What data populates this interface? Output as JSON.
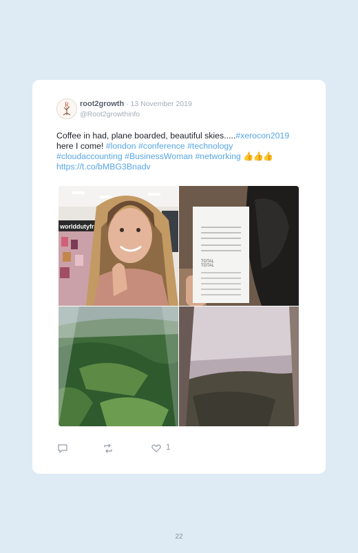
{
  "tweet": {
    "author_name": "root2growth",
    "separator": " · ",
    "date": "13 November 2019",
    "handle": "@Root2growthinfo",
    "avatar_letter": "R",
    "text": {
      "t1": "Coffee in had, plane boarded, beautiful skies.....",
      "l1": "#xerocon2019",
      "t2": " here I come! ",
      "l2": "#london",
      "t3": " ",
      "l3": "#conference",
      "t4": " ",
      "l4": "#technology",
      "t5": " ",
      "l5": "#cloudaccounting",
      "t6": " ",
      "l6": "#BusinessWoman",
      "t7": " ",
      "l7": "#networking",
      "t8": " ",
      "emoji": "👍👍👍",
      "t9": " ",
      "l8": "https://t.co/bMBG3Bnadv"
    },
    "media": [
      {
        "kind": "photo",
        "subject": "selfie-thumbs-up",
        "sign_text": "worlddutyfree"
      },
      {
        "kind": "photo",
        "subject": "receipt",
        "receipt_total_label": "TOTAL",
        "receipt_total_label_2": "TOTAL"
      },
      {
        "kind": "photo",
        "subject": "aerial-countryside"
      },
      {
        "kind": "photo",
        "subject": "aerial-coast-sky"
      }
    ],
    "actions": {
      "reply_icon": "reply-icon",
      "retweet_icon": "retweet-icon",
      "like_icon": "heart-icon",
      "like_count": "1"
    }
  },
  "page": {
    "number": "22"
  },
  "colors": {
    "background": "#deeaf4",
    "card": "#ffffff",
    "link": "#55a6e4",
    "muted": "#a3acb6"
  }
}
